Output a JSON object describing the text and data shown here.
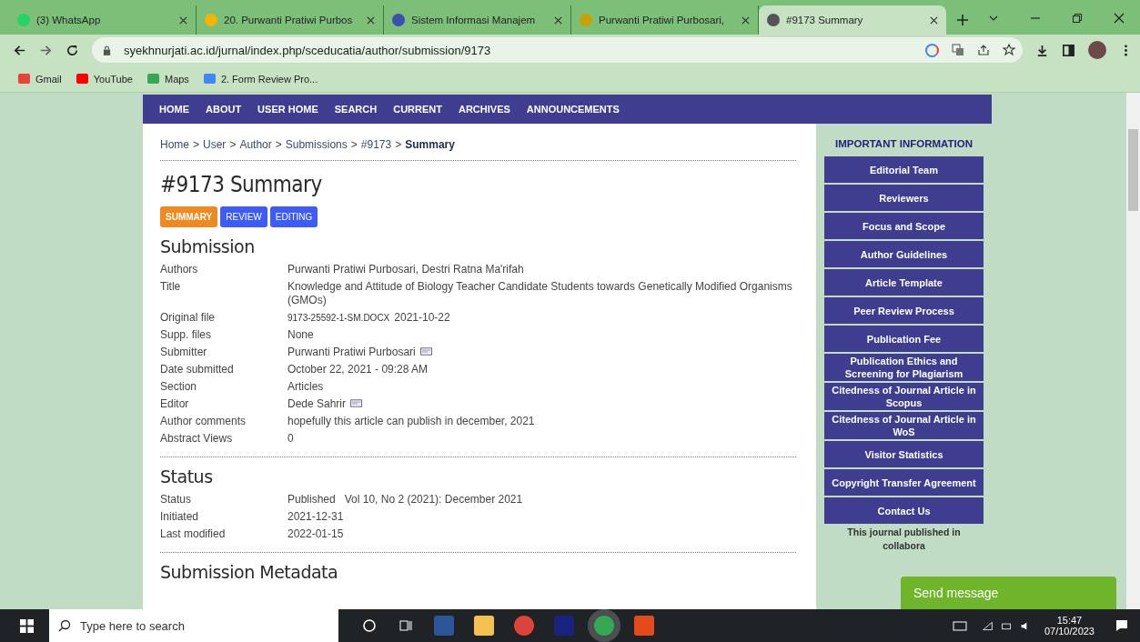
{
  "browser": {
    "tabs": [
      {
        "title": "(3) WhatsApp",
        "selected": false
      },
      {
        "title": "20. Purwanti Pratiwi Purbos",
        "selected": false
      },
      {
        "title": "Sistem Informasi Manajem",
        "selected": false
      },
      {
        "title": "Purwanti Pratiwi Purbosari,",
        "selected": false
      },
      {
        "title": "#9173 Summary",
        "selected": true
      }
    ],
    "url": "syekhnurjati.ac.id/jurnal/index.php/sceducatia/author/submission/9173",
    "bookmarks": [
      "Gmail",
      "YouTube",
      "Maps",
      "2. Form Review Pro..."
    ]
  },
  "nav": [
    "HOME",
    "ABOUT",
    "USER HOME",
    "SEARCH",
    "CURRENT",
    "ARCHIVES",
    "ANNOUNCEMENTS"
  ],
  "breadcrumb_separator": ">",
  "breadcrumb": [
    {
      "label": "Home",
      "current": false
    },
    {
      "label": "User",
      "current": false
    },
    {
      "label": "Author",
      "current": false
    },
    {
      "label": "Submissions",
      "current": false
    },
    {
      "label": "#9173",
      "current": false
    },
    {
      "label": "Summary",
      "current": true
    }
  ],
  "page_title": "#9173 Summary",
  "subtabs": [
    {
      "label": "SUMMARY",
      "selected": true
    },
    {
      "label": "REVIEW",
      "selected": false
    },
    {
      "label": "EDITING",
      "selected": false
    }
  ],
  "sections": [
    {
      "heading": "Submission",
      "rows": [
        {
          "label": "Authors",
          "value": "Purwanti Pratiwi Purbosari, Destri Ratna Ma'rifah"
        },
        {
          "label": "Title",
          "value": "Knowledge and Attitude of Biology Teacher Candidate Students towards Genetically Modified Organisms (GMOs)"
        },
        {
          "label": "Original file",
          "file": "9173-25592-1-SM.DOCX",
          "value": "2021-10-22"
        },
        {
          "label": "Supp. files",
          "value": "None"
        },
        {
          "label": "Submitter",
          "value": "Purwanti Pratiwi Purbosari",
          "email": true
        },
        {
          "label": "Date submitted",
          "value": "October 22, 2021 - 09:28 AM"
        },
        {
          "label": "Section",
          "value": "Articles"
        },
        {
          "label": "Editor",
          "value": "Dede Sahrir",
          "email": true
        },
        {
          "label": "Author comments",
          "value": "hopefully this article can publish in december, 2021"
        },
        {
          "label": "Abstract Views",
          "value": "0"
        }
      ]
    },
    {
      "heading": "Status",
      "rows": [
        {
          "label": "Status",
          "value": "Published",
          "extra": "Vol 10, No 2 (2021): December 2021"
        },
        {
          "label": "Initiated",
          "value": "2021-12-31"
        },
        {
          "label": "Last modified",
          "value": "2022-01-15"
        }
      ]
    },
    {
      "heading": "Submission Metadata"
    }
  ],
  "sidebar": {
    "heading": "IMPORTANT INFORMATION",
    "items": [
      "Editorial Team",
      "Reviewers",
      "Focus and Scope",
      "Author Guidelines",
      "Article Template",
      "Peer Review Process",
      "Publication Fee",
      "Publication Ethics and Screening for Plagiarism",
      "Citedness of Journal Article in Scopus",
      "Citedness of Journal Article in WoS",
      "Visitor Statistics",
      "Copyright Transfer Agreement",
      "Contact Us"
    ],
    "note": "This journal published in collabora"
  },
  "chat_button": "Send message",
  "taskbar": {
    "search_placeholder": "Type here to search",
    "time": "15:47",
    "date": "07/10/2023"
  }
}
